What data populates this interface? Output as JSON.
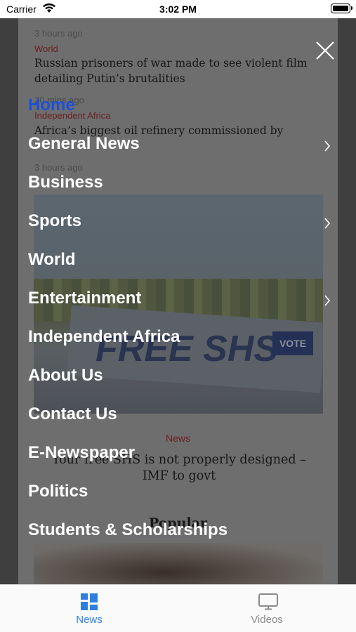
{
  "status_bar": {
    "carrier": "Carrier",
    "time": "3:02 PM"
  },
  "background_feed": {
    "items": [
      {
        "time": "3 hours ago",
        "category": "World",
        "headline": "Russian prisoners of war made to see violent film detailing Putin’s brutalities"
      },
      {
        "time": "20 mins ago",
        "category": "Independent Africa",
        "headline": "Africa’s biggest oil refinery commissioned by"
      },
      {
        "time": "3 hours ago"
      }
    ],
    "image_banner_text": "FREE SHS",
    "image_vote_text": "VOTE",
    "featured_category": "News",
    "featured_headline": "Your free SHS is not properly designed – IMF to govt",
    "section_title": "Popular"
  },
  "menu": {
    "items": [
      {
        "label": "Home",
        "active": true,
        "has_submenu": false
      },
      {
        "label": "General News",
        "has_submenu": true
      },
      {
        "label": "Business",
        "has_submenu": false
      },
      {
        "label": "Sports",
        "has_submenu": true
      },
      {
        "label": "World",
        "has_submenu": false
      },
      {
        "label": "Entertainment",
        "has_submenu": true
      },
      {
        "label": "Independent Africa",
        "has_submenu": false
      },
      {
        "label": "About Us",
        "has_submenu": false
      },
      {
        "label": "Contact Us",
        "has_submenu": false
      },
      {
        "label": "E-Newspaper",
        "has_submenu": false
      },
      {
        "label": "Politics",
        "has_submenu": false
      },
      {
        "label": "Students & Scholarships",
        "has_submenu": false
      }
    ],
    "close_icon": "close-icon",
    "chevron_icon": "chevron-right-icon",
    "active_color": "#1b50d8"
  },
  "tab_bar": {
    "tabs": [
      {
        "label": "News",
        "icon": "grid-icon",
        "selected": true,
        "color": "#2f7fe0"
      },
      {
        "label": "Videos",
        "icon": "tv-icon",
        "selected": false,
        "color": "#8a8a8a"
      }
    ]
  }
}
